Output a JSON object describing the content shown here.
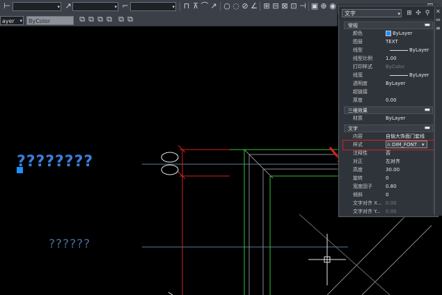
{
  "toolbar": {
    "layer_combo_value": "ayer",
    "bycolor_combo_value": "ByColor"
  },
  "canvas": {
    "question_text_large": "????????",
    "question_text_small": "??????",
    "accent_colors": {
      "selected_text": "#3b7fd9",
      "dim_text": "#4a6a9a",
      "red_line": "#d42020",
      "green_line": "#2ec92e",
      "grip": "#1e90ff"
    }
  },
  "properties": {
    "object_type": "文字",
    "sections": {
      "general": {
        "title": "常规",
        "rows": [
          {
            "label": "颜色",
            "value": "ByLayer"
          },
          {
            "label": "图层",
            "value": "TEXT"
          },
          {
            "label": "线型",
            "value": "ByLayer"
          },
          {
            "label": "线型比例",
            "value": "1.00"
          },
          {
            "label": "打印样式",
            "value": "ByColor"
          },
          {
            "label": "线宽",
            "value": "ByLayer"
          },
          {
            "label": "透明度",
            "value": "ByLayer"
          },
          {
            "label": "超链接",
            "value": ""
          },
          {
            "label": "厚度",
            "value": "0.00"
          }
        ]
      },
      "3d": {
        "title": "三维效果",
        "rows": [
          {
            "label": "材质",
            "value": "ByLayer"
          }
        ]
      },
      "text": {
        "title": "文字",
        "rows": [
          {
            "label": "内容",
            "value": "自愉大饰面门套线"
          },
          {
            "label": "样式",
            "value": "DIM_FONT"
          },
          {
            "label": "注释性",
            "value": "否"
          },
          {
            "label": "对正",
            "value": "左对齐"
          },
          {
            "label": "高度",
            "value": "30.00"
          },
          {
            "label": "旋转",
            "value": "0"
          },
          {
            "label": "宽度因子",
            "value": "0.80"
          },
          {
            "label": "倾斜",
            "value": "0"
          },
          {
            "label": "文字对齐 X...",
            "value": "0.00"
          },
          {
            "label": "文字对齐 Y...",
            "value": "0.00"
          }
        ]
      }
    }
  }
}
